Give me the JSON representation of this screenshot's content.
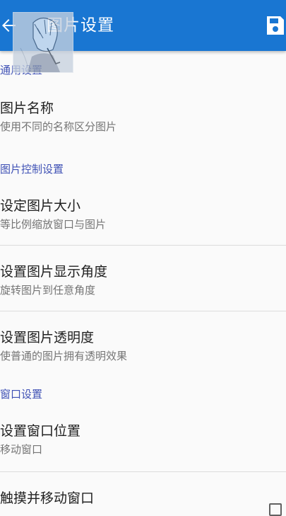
{
  "appbar": {
    "title": "图片设置",
    "accent": "#1976d2"
  },
  "sections": [
    {
      "header": "通用设置",
      "items": [
        {
          "title": "图片名称",
          "summary": "使用不同的名称区分图片"
        }
      ]
    },
    {
      "header": "图片控制设置",
      "items": [
        {
          "title": "设定图片大小",
          "summary": "等比例缩放窗口与图片"
        },
        {
          "title": "设置图片显示角度",
          "summary": "旋转图片到任意角度"
        },
        {
          "title": "设置图片透明度",
          "summary": "使普通的图片拥有透明效果"
        }
      ]
    },
    {
      "header": "窗口设置",
      "items": [
        {
          "title": "设置窗口位置",
          "summary": "移动窗口"
        },
        {
          "title": "触摸并移动窗口",
          "checked": false
        }
      ]
    }
  ],
  "icons": {
    "back": "arrow-back-icon",
    "save": "save-icon"
  },
  "colors": {
    "section_header": "#3f51b5",
    "summary": "#757575"
  }
}
